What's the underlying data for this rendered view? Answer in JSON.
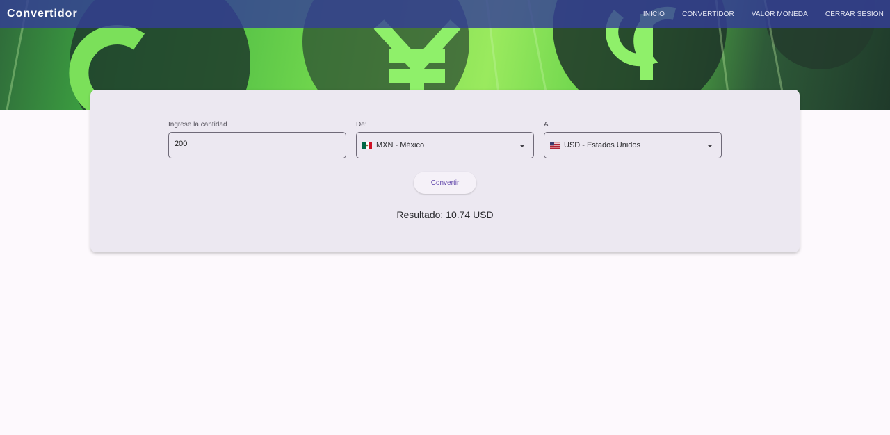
{
  "app": {
    "title": "Convertidor"
  },
  "nav": {
    "items": [
      {
        "label": "INICIO"
      },
      {
        "label": "CONVERTIDOR"
      },
      {
        "label": "VALOR MONEDA"
      },
      {
        "label": "CERRAR SESION"
      }
    ]
  },
  "hero": {
    "icons": [
      "currency-c-icon",
      "yen-icon",
      "dollar-icon"
    ]
  },
  "form": {
    "amount": {
      "label": "Ingrese la cantidad",
      "value": "200"
    },
    "from": {
      "label": "De:",
      "value": "MXN - México",
      "flag": "mexico-flag-icon"
    },
    "to": {
      "label": "A",
      "value": "USD - Estados Unidos",
      "flag": "usa-flag-icon"
    },
    "button": {
      "label": "Convertir"
    },
    "result": "Resultado: 10.74 USD"
  },
  "colors": {
    "topbar": "#343e96",
    "card": "#ece8f1",
    "button_text": "#6248ab",
    "page": "#fdf9fd"
  }
}
